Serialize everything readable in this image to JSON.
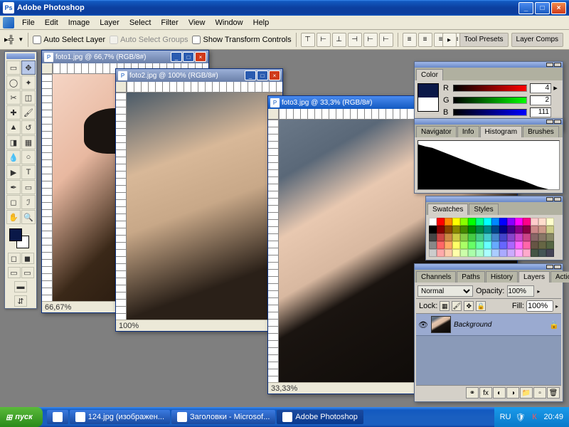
{
  "window": {
    "title": "Adobe Photoshop"
  },
  "menu": [
    "File",
    "Edit",
    "Image",
    "Layer",
    "Select",
    "Filter",
    "View",
    "Window",
    "Help"
  ],
  "options": {
    "autoSelectLayer": "Auto Select Layer",
    "autoSelectGroups": "Auto Select Groups",
    "showTransform": "Show Transform Controls"
  },
  "palette_wells": [
    "Tool Presets",
    "Layer Comps"
  ],
  "docs": [
    {
      "title": "foto1.jpg @ 66,7% (RGB/8#)",
      "zoom": "66,67%"
    },
    {
      "title": "foto2.jpg @ 100% (RGB/8#)",
      "zoom": "100%"
    },
    {
      "title": "foto3.jpg @ 33,3% (RGB/8#)",
      "zoom": "33,33%"
    }
  ],
  "color_panel": {
    "tab": "Color",
    "r": "4",
    "g": "2",
    "b": "111",
    "fg": "#0a1848",
    "bg": "#ffffff"
  },
  "histogram_panel": {
    "tabs": [
      "Navigator",
      "Info",
      "Histogram",
      "Brushes"
    ]
  },
  "swatches_panel": {
    "tabs": [
      "Swatches",
      "Styles"
    ]
  },
  "layers_panel": {
    "tabs": [
      "Channels",
      "Paths",
      "History",
      "Layers",
      "Actions"
    ],
    "blend": "Normal",
    "opacityLabel": "Opacity:",
    "opacity": "100%",
    "lockLabel": "Lock:",
    "fillLabel": "Fill:",
    "fill": "100%",
    "layer": {
      "name": "Background"
    }
  },
  "taskbar": {
    "start": "пуск",
    "items": [
      "",
      "124.jpg (изображен...",
      "Заголовки - Microsof...",
      "Adobe Photoshop"
    ],
    "lang": "RU",
    "time": "20:49"
  },
  "swatch_colors": [
    "#ffffff",
    "#ff0000",
    "#ff8800",
    "#ffff00",
    "#88ff00",
    "#00ff00",
    "#00ff88",
    "#00ffff",
    "#0088ff",
    "#0000ff",
    "#8800ff",
    "#ff00ff",
    "#ff0088",
    "#ffcccc",
    "#ffddcc",
    "#ffffcc",
    "#000000",
    "#880000",
    "#884400",
    "#888800",
    "#448800",
    "#008800",
    "#008844",
    "#008888",
    "#004488",
    "#000088",
    "#440088",
    "#880088",
    "#880044",
    "#cc8888",
    "#cc9988",
    "#cccc88",
    "#444444",
    "#cc4444",
    "#cc8844",
    "#cccc44",
    "#88cc44",
    "#44cc44",
    "#44cc88",
    "#44cccc",
    "#4488cc",
    "#4444cc",
    "#8844cc",
    "#cc44cc",
    "#cc4488",
    "#886666",
    "#887766",
    "#888866",
    "#888888",
    "#ff6666",
    "#ffaa66",
    "#ffff66",
    "#aaff66",
    "#66ff66",
    "#66ffaa",
    "#66ffff",
    "#66aaff",
    "#6666ff",
    "#aa66ff",
    "#ff66ff",
    "#ff66aa",
    "#665544",
    "#666644",
    "#556644",
    "#cccccc",
    "#ffaaaa",
    "#ffccaa",
    "#ffffaa",
    "#ccffaa",
    "#aaffaa",
    "#aaffcc",
    "#aaffff",
    "#aaccff",
    "#aaaaff",
    "#ccaaff",
    "#ffaaff",
    "#ffaacc",
    "#445544",
    "#445555",
    "#444455"
  ]
}
